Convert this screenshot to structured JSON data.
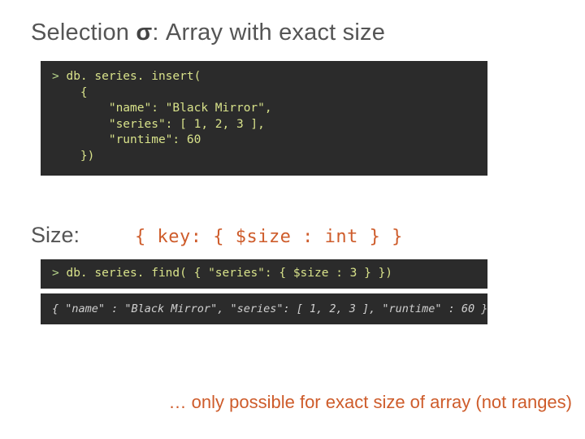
{
  "title": {
    "pre": "Selection ",
    "sigma": "σ",
    "post": ": Array with exact size"
  },
  "code_insert": {
    "prompt": ">",
    "cmd": "db. series. insert(",
    "body1": "    {",
    "body2": "        \"name\": \"Black Mirror\",",
    "body3": "        \"series\": [ 1, 2, 3 ],",
    "body4": "        \"runtime\": 60",
    "body5": "    })"
  },
  "size_row": {
    "label": "Size:",
    "expr": "{ key: { $size : int } }"
  },
  "code_find": {
    "prompt": ">",
    "line": "db. series. find( { \"series\": { $size : 3 } })"
  },
  "result_line": "{ \"name\" : \"Black Mirror\", \"series\": [ 1, 2, 3 ], \"runtime\" : 60 }",
  "footnote": "… only possible for exact size of array (not ranges)"
}
